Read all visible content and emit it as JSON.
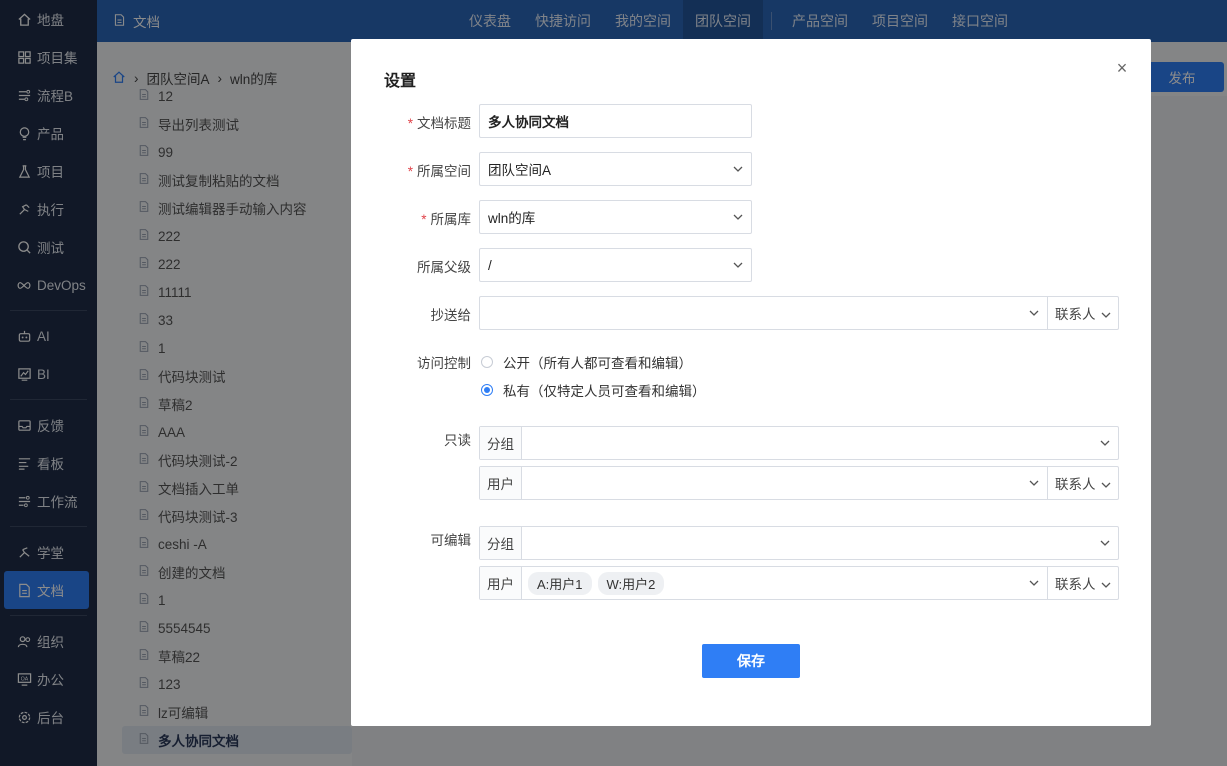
{
  "sidebar": {
    "items": [
      {
        "label": "地盘",
        "icon": "home-icon"
      },
      {
        "label": "项目集",
        "icon": "grid-icon"
      },
      {
        "label": "流程B",
        "icon": "flow-icon"
      },
      {
        "label": "产品",
        "icon": "bulb-icon"
      },
      {
        "label": "项目",
        "icon": "flask-icon"
      },
      {
        "label": "执行",
        "icon": "run-icon"
      },
      {
        "label": "测试",
        "icon": "search-icon"
      },
      {
        "label": "DevOps",
        "icon": "infinity-icon"
      },
      {
        "label": "AI",
        "icon": "robot-icon"
      },
      {
        "label": "BI",
        "icon": "chart-icon"
      },
      {
        "label": "反馈",
        "icon": "inbox-icon"
      },
      {
        "label": "看板",
        "icon": "board-icon"
      },
      {
        "label": "工作流",
        "icon": "workflow-icon"
      },
      {
        "label": "学堂",
        "icon": "learn-icon"
      },
      {
        "label": "文档",
        "icon": "document-icon"
      },
      {
        "label": "组织",
        "icon": "people-icon"
      },
      {
        "label": "办公",
        "icon": "oa-icon"
      },
      {
        "label": "后台",
        "icon": "gear-icon"
      }
    ]
  },
  "topbar": {
    "section": "文档",
    "nav": [
      "仪表盘",
      "快捷访问",
      "我的空间",
      "团队空间",
      "产品空间",
      "项目空间",
      "接口空间"
    ]
  },
  "breadcrumb": {
    "space": "团队空间A",
    "lib": "wln的库"
  },
  "publish_label": "发布",
  "doclist": [
    "12",
    "导出列表测试",
    "99",
    "测试复制粘贴的文档",
    "测试编辑器手动输入内容",
    "222",
    "222",
    "11111",
    "33",
    "1",
    "代码块测试",
    "草稿2",
    "AAA",
    "代码块测试-2",
    "文档插入工单",
    "代码块测试-3",
    "ceshi -A",
    "创建的文档",
    "1",
    "5554545",
    "草稿22",
    "123",
    "lz可编辑",
    "多人协同文档"
  ],
  "modal": {
    "title": "设置",
    "close": "×",
    "doc_title_label": "文档标题",
    "doc_title_value": "多人协同文档",
    "space_label": "所属空间",
    "space_value": "团队空间A",
    "lib_label": "所属库",
    "lib_value": "wln的库",
    "parent_label": "所属父级",
    "parent_value": "/",
    "cc_label": "抄送给",
    "contact_label": "联系人",
    "access_label": "访问控制",
    "access_public": "公开（所有人都可查看和编辑）",
    "access_private": "私有（仅特定人员可查看和编辑）",
    "readonly_label": "只读",
    "editable_label": "可编辑",
    "group_label": "分组",
    "user_label": "用户",
    "editable_users": [
      "A:用户1",
      "W:用户2"
    ],
    "save_label": "保存"
  }
}
